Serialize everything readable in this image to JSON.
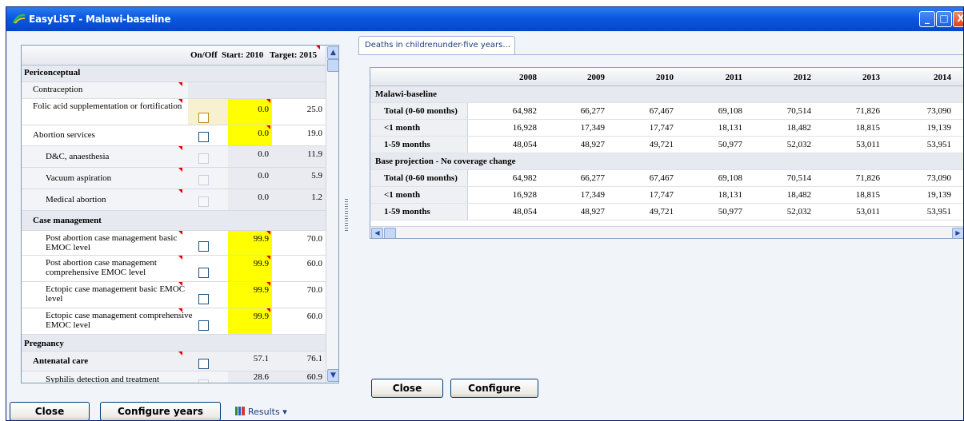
{
  "window": {
    "title": "EasyLiST - Malawi-baseline",
    "controls": {
      "minimize": "_",
      "maximize": "□",
      "close": "X"
    }
  },
  "left_grid": {
    "headers": {
      "onoff": "On/Off",
      "start": "Start: 2010",
      "target": "Target: 2015"
    },
    "rows": [
      {
        "label": "Periconceptual",
        "type": "section"
      },
      {
        "label": "Contraception",
        "type": "sub"
      },
      {
        "label": "Folic acid supplementation or fortification",
        "type": "item",
        "start": "0.0",
        "target": "25.0",
        "start_yellow": true,
        "checkbox": "focused"
      },
      {
        "label": "Abortion services",
        "type": "item",
        "start": "0.0",
        "target": "19.0",
        "start_yellow": true,
        "checkbox": "enabled"
      },
      {
        "label": "D&C, anaesthesia",
        "type": "subitem",
        "start": "0.0",
        "target": "11.9",
        "checkbox": "disabled"
      },
      {
        "label": "Vacuum aspiration",
        "type": "subitem",
        "start": "0.0",
        "target": "5.9",
        "checkbox": "disabled"
      },
      {
        "label": "Medical abortion",
        "type": "subitem",
        "start": "0.0",
        "target": "1.2",
        "checkbox": "disabled"
      },
      {
        "label": "Case management",
        "type": "subhead"
      },
      {
        "label": "Post abortion case management basic EMOC level",
        "type": "item2",
        "start": "99.9",
        "target": "70.0",
        "start_yellow": true,
        "checkbox": "enabled"
      },
      {
        "label": "Post abortion case management comprehensive EMOC level",
        "type": "item2",
        "start": "99.9",
        "target": "60.0",
        "start_yellow": true,
        "checkbox": "enabled"
      },
      {
        "label": "Ectopic case management basic EMOC level",
        "type": "item2",
        "start": "99.9",
        "target": "70.0",
        "start_yellow": true,
        "checkbox": "enabled"
      },
      {
        "label": "Ectopic case management comprehensive EMOC level",
        "type": "item2",
        "start": "99.9",
        "target": "60.0",
        "start_yellow": true,
        "checkbox": "enabled"
      },
      {
        "label": "Pregnancy",
        "type": "section"
      },
      {
        "label": "Antenatal care",
        "type": "subhead-item",
        "start": "57.1",
        "target": "76.1",
        "checkbox": "enabled"
      },
      {
        "label": "Syphilis detection and treatment",
        "type": "subitem",
        "start": "28.6",
        "target": "60.9",
        "checkbox": "disabled"
      }
    ]
  },
  "right_panel": {
    "tab_label": "Deaths in childrenunder-five years...",
    "years": [
      "2008",
      "2009",
      "2010",
      "2011",
      "2012",
      "2013",
      "2014"
    ],
    "groups": [
      {
        "name": "Malawi-baseline",
        "rows": [
          {
            "label": "Total (0-60 months)",
            "values": [
              "64,982",
              "66,277",
              "67,467",
              "69,108",
              "70,514",
              "71,826",
              "73,090"
            ]
          },
          {
            "label": "<1 month",
            "values": [
              "16,928",
              "17,349",
              "17,747",
              "18,131",
              "18,482",
              "18,815",
              "19,139"
            ]
          },
          {
            "label": "1-59 months",
            "values": [
              "48,054",
              "48,927",
              "49,721",
              "50,977",
              "52,032",
              "53,011",
              "53,951"
            ]
          }
        ]
      },
      {
        "name": "Base projection - No coverage change",
        "rows": [
          {
            "label": "Total (0-60 months)",
            "values": [
              "64,982",
              "66,277",
              "67,467",
              "69,108",
              "70,514",
              "71,826",
              "73,090"
            ]
          },
          {
            "label": "<1 month",
            "values": [
              "16,928",
              "17,349",
              "17,747",
              "18,131",
              "18,482",
              "18,815",
              "19,139"
            ]
          },
          {
            "label": "1-59 months",
            "values": [
              "48,054",
              "48,927",
              "49,721",
              "50,977",
              "52,032",
              "53,011",
              "53,951"
            ]
          }
        ]
      }
    ],
    "close_label": "Close",
    "configure_label": "Configure"
  },
  "bottom": {
    "close_label": "Close",
    "configure_years_label": "Configure years",
    "results_label": "Results",
    "results_arrow": "▾"
  }
}
